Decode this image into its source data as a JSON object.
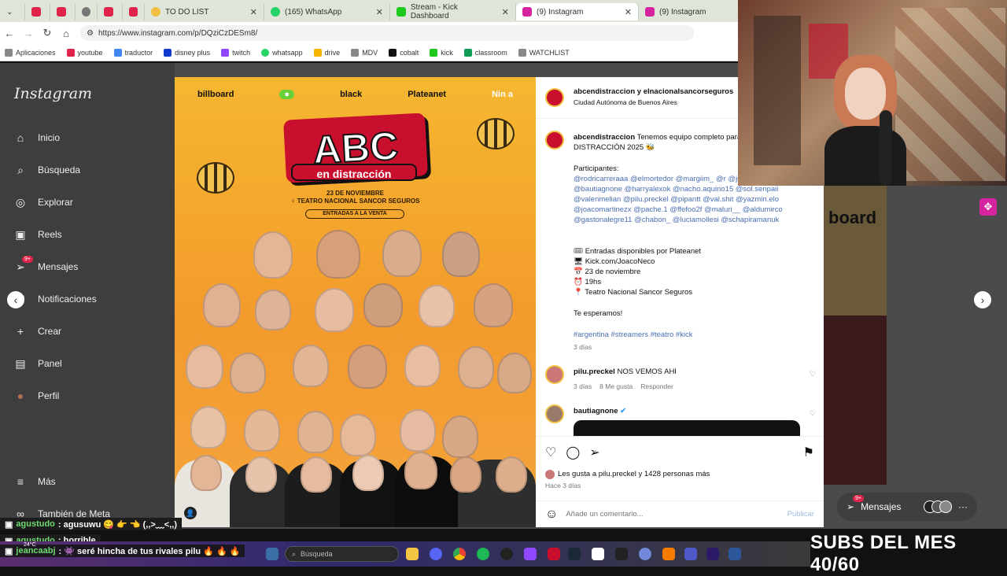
{
  "browser": {
    "tabs": [
      {
        "label": "",
        "color": "#e0234a"
      },
      {
        "label": "",
        "color": "#e0234a"
      },
      {
        "label": "",
        "color": "#555555"
      },
      {
        "label": "",
        "color": "#e0234a"
      },
      {
        "label": "",
        "color": "#e0234a"
      },
      {
        "label": "TO DO LIST",
        "color": "#f0c040"
      },
      {
        "label": "(165) WhatsApp",
        "color": "#25d366"
      },
      {
        "label": "Stream - Kick Dashboard",
        "color": "#1cc91c"
      },
      {
        "label": "(9) Instagram",
        "color": "#d6249f"
      },
      {
        "label": "(9) Instagram",
        "color": "#d6249f"
      }
    ],
    "url": "https://www.instagram.com/p/DQziCzDESm8/",
    "bookmarks": [
      {
        "label": "Aplicaciones",
        "color": "#888888"
      },
      {
        "label": "youtube",
        "color": "#e0234a"
      },
      {
        "label": "traductor",
        "color": "#4285f4"
      },
      {
        "label": "disney plus",
        "color": "#113ccf"
      },
      {
        "label": "twitch",
        "color": "#9146ff"
      },
      {
        "label": "whatsapp",
        "color": "#25d366"
      },
      {
        "label": "drive",
        "color": "#f4b400"
      },
      {
        "label": "MDV",
        "color": "#888888"
      },
      {
        "label": "cobalt",
        "color": "#111111"
      },
      {
        "label": "kick",
        "color": "#1cc91c"
      },
      {
        "label": "classroom",
        "color": "#0f9d58"
      },
      {
        "label": "WATCHLIST",
        "color": "#888888"
      }
    ]
  },
  "sidebar": {
    "logo": "Instagram",
    "items": [
      {
        "label": "Inicio",
        "icon": "⌂"
      },
      {
        "label": "Búsqueda",
        "icon": "⌕"
      },
      {
        "label": "Explorar",
        "icon": "◎"
      },
      {
        "label": "Reels",
        "icon": "▣"
      },
      {
        "label": "Mensajes",
        "icon": "➢"
      },
      {
        "label": "Notificaciones",
        "icon": "♡"
      },
      {
        "label": "Crear",
        "icon": "+"
      },
      {
        "label": "Panel",
        "icon": "▤"
      },
      {
        "label": "Perfil",
        "icon": "●"
      }
    ],
    "messages_badge": "9+",
    "more": "Más",
    "also_meta": "También de Meta"
  },
  "poster": {
    "brands": [
      "billboard",
      "",
      "black",
      "Plateanet",
      "Nin a"
    ],
    "title": "ABC",
    "subtitle": "en distracción",
    "date": "23 DE NOVIEMBRE",
    "venue": "♀ TEATRO NACIONAL SANCOR SEGUROS",
    "tickets": "ENTRADAS A LA VENTA"
  },
  "post": {
    "header_users": "abcendistraccion y elnacionalsancorseguros",
    "location": "Ciudad Autónoma de Buenos Aires",
    "caption_user": "abcendistraccion",
    "caption_text": "Tenemos equipo completo para ABC EN DISTRACCIÓN 2025 🐝",
    "participants_label": "Participantes:",
    "participants": "@rodricarreraaa @elmortedor @margiim_ @r @julimanzotti @bautiagnone @harryalexok @nacho.aquino15 @sol.senpaii @valenmelian @pilu.preckel @pipantt @val.shit @yazmin.elo @joacomartinezx @pache.1 @ffefoo2f @maluri__ @aldumirco @gastonalegre11 @chabon_ @luciamollesi @schapiramanuk",
    "info": [
      "🎟 Entradas disponibles por Plateanet",
      "🖥 Kick.com/JoacoNeco",
      "📅 23 de noviembre",
      "⏰ 19hs",
      "📍 Teatro Nacional Sancor Seguros"
    ],
    "closing": "Te esperamos!",
    "hashtags": "#argentina #streamers #teatro #kick",
    "caption_time": "3 días",
    "comments": [
      {
        "user": "pilu.preckel",
        "text": "NOS VEMOS AHI",
        "time": "3 días",
        "likes": "8 Me gusta",
        "reply": "Responder"
      },
      {
        "user": "bautiagnone",
        "text": "",
        "time": "",
        "likes": "",
        "reply": ""
      }
    ],
    "likes_text": "Les gusta a pilu.preckel y 1428 personas más",
    "posted": "Hace 3 días",
    "comment_placeholder": "Añade un comentario...",
    "publish": "Publicar"
  },
  "messages_pill": {
    "label": "Mensajes",
    "badge": "9+"
  },
  "chat": [
    {
      "user": "agustudo",
      "text": ": agusuwu 😋 👉 👈 (,,>﹏<,,)"
    },
    {
      "user": "agustudo",
      "text": ": horrible"
    },
    {
      "user": "jeancaabj",
      "text": ": 👾 seré hincha de tus rivales pilu 🔥 🔥 🔥"
    }
  ],
  "taskbar": {
    "search_placeholder": "Búsqueda",
    "weather": "24°C"
  },
  "overlay": {
    "subs": "SUBS DEL MES 40/60"
  }
}
